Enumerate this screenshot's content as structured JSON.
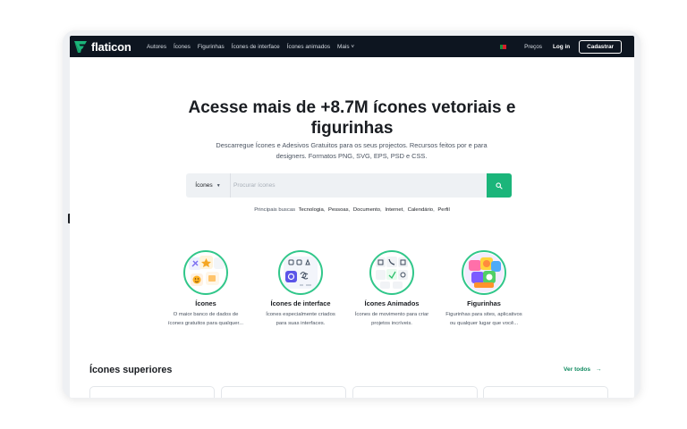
{
  "brand": {
    "name": "flaticon",
    "color": "#1bb57a"
  },
  "nav": {
    "links": [
      "Autores",
      "Ícones",
      "Figurinhas",
      "Ícones de interface",
      "Ícones animados",
      "Mais"
    ],
    "more_caret": "˅",
    "prices": "Preços",
    "login": "Log in",
    "signup": "Cadastrar"
  },
  "hero": {
    "title_line1": "Acesse mais de +8.7M ícones vetoriais e",
    "title_line2": "figurinhas",
    "subtitle_line1": "Descarregue Ícones e Adesivos Gratuitos para os seus projectos. Recursos feitos por e para",
    "subtitle_line2": "designers. Formatos PNG, SVG, EPS, PSD e CSS."
  },
  "search": {
    "type_label": "Ícones",
    "placeholder": "Procurar ícones",
    "button_icon": "search-icon"
  },
  "popular": {
    "label": "Principais buscas",
    "terms": [
      "Tecnologia",
      "Pessoas",
      "Documento",
      "Internet",
      "Calendário",
      "Perfil"
    ]
  },
  "categories": [
    {
      "title": "Ícones",
      "desc_line1": "O maior banco de dados de",
      "desc_line2": "ícones gratuitos para qualquer..."
    },
    {
      "title": "Ícones de interface",
      "desc_line1": "Ícones especialmente criados",
      "desc_line2": "para suas interfaces."
    },
    {
      "title": "Ícones Animados",
      "desc_line1": "Ícones de movimento para criar",
      "desc_line2": "projetos incríveis."
    },
    {
      "title": "Figurinhas",
      "desc_line1": "Figurinhas para sites, aplicativos",
      "desc_line2": "ou qualquer lugar que você..."
    }
  ],
  "top_icons": {
    "title": "Ícones superiores",
    "see_all": "Ver todos",
    "arrow": "→"
  },
  "colors": {
    "nav_bg": "#0d1520",
    "accent": "#1bb57a",
    "link_green": "#0f8a5f"
  }
}
